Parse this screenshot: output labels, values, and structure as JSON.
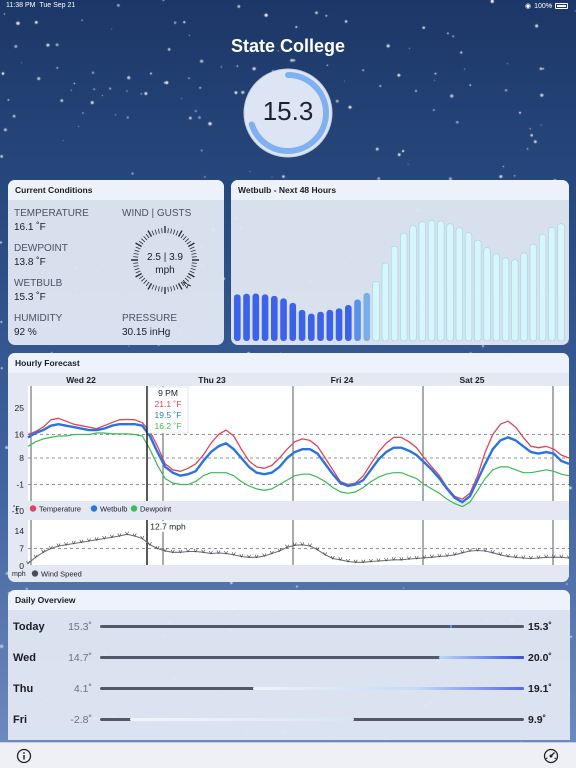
{
  "status": {
    "time": "11:38 PM",
    "date": "Tue Sep 21",
    "battery": "100%"
  },
  "location": {
    "name": "State College"
  },
  "wetbulb_gauge": {
    "value": "15.3",
    "fraction": 0.7
  },
  "current": {
    "title": "Current Conditions",
    "temperature": {
      "label": "TEMPERATURE",
      "value": "16.1 ˚F"
    },
    "dewpoint": {
      "label": "DEWPOINT",
      "value": "13.8 ˚F"
    },
    "wetbulb": {
      "label": "WETBULB",
      "value": "15.3 ˚F"
    },
    "humidity": {
      "label": "HUMIDITY",
      "value": "92 %"
    },
    "wind": {
      "label": "WIND | GUSTS",
      "value": "2.5 | 3.9",
      "unit": "mph"
    },
    "pressure": {
      "label": "PRESSURE",
      "value": "30.15 inHg"
    }
  },
  "wetbulb48": {
    "title": "Wetbulb - Next 48 Hours",
    "values": [
      15.3,
      15.5,
      15.6,
      15.3,
      14.8,
      14,
      12.5,
      10.2,
      9,
      9.6,
      10.2,
      10.7,
      11.8,
      13.6,
      15.8,
      19.6,
      25.6,
      31.1,
      35.4,
      37.9,
      39.2,
      39.6,
      39.4,
      38.5,
      37.2,
      35.6,
      33.1,
      30.7,
      28.6,
      27.3,
      26.7,
      28.9,
      31.8,
      35.1,
      37.3,
      38.5
    ]
  },
  "hourly": {
    "title": "Hourly Forecast",
    "days": [
      "Wed 22",
      "Thu 23",
      "Fri 24",
      "Sat 25"
    ],
    "y_ticks": [
      "25",
      "16",
      "8",
      "-1",
      "-10"
    ],
    "unit": "˚F",
    "tooltip": {
      "time": "9 PM",
      "temperature": "21.1 ˚F",
      "wetbulb": "19.5 ˚F",
      "dewpoint": "16.2 ˚F"
    },
    "legend": {
      "temperature": "Temperature",
      "wetbulb": "Wetbulb",
      "dewpoint": "Dewpoint"
    },
    "colors": {
      "temperature": "#e0435a",
      "wetbulb": "#2a74e0",
      "dewpoint": "#3cba55"
    },
    "temperature": [
      16,
      17,
      18.5,
      21,
      21.5,
      20.5,
      19.5,
      19,
      18.5,
      18,
      19,
      20,
      21,
      21.1,
      21,
      20,
      17,
      12,
      6,
      4,
      3.5,
      4.5,
      6,
      9,
      13,
      16,
      17.5,
      15.5,
      11,
      7,
      5,
      4.5,
      5.5,
      8,
      11,
      13.5,
      14.5,
      14,
      12,
      8,
      4,
      0,
      -1,
      -0.5,
      2,
      6,
      10,
      13,
      15,
      15,
      13.5,
      11.5,
      8,
      5,
      2,
      -2,
      -5,
      -6,
      -4,
      2,
      10,
      16,
      19.5,
      20.5,
      18.5,
      15,
      12,
      11.5,
      12,
      11,
      9,
      8
    ],
    "wetbulb": [
      15,
      16.5,
      17.5,
      19,
      19.5,
      19,
      18.5,
      18,
      17.5,
      17.5,
      18,
      19,
      19.5,
      19.5,
      19.5,
      19,
      15.5,
      10,
      5,
      3,
      2,
      2.5,
      3.5,
      7,
      10,
      12,
      13,
      11,
      8,
      5,
      3,
      2.5,
      3,
      5,
      8,
      10,
      11,
      11,
      9.5,
      6,
      2.5,
      -0.5,
      -1.5,
      -1,
      0.5,
      4,
      7.5,
      10,
      11.5,
      11.5,
      10.5,
      9,
      6.5,
      4,
      1,
      -2.5,
      -5.5,
      -7,
      -5,
      0.5,
      6,
      11,
      14,
      15,
      14,
      12,
      10,
      9.5,
      10,
      9.5,
      7,
      6
    ],
    "dewpoint": [
      12,
      13.5,
      14.5,
      15,
      15.5,
      15.5,
      16,
      16,
      16,
      16.5,
      16.5,
      16.2,
      16.2,
      16.2,
      16,
      15.5,
      11,
      5.5,
      1,
      -0.5,
      -1,
      -1,
      0,
      2,
      3,
      3,
      3,
      2,
      0,
      -1.5,
      -2.5,
      -3,
      -2.5,
      -1,
      0.5,
      2,
      2.5,
      2.5,
      1.5,
      0,
      -2,
      -3.5,
      -4,
      -3.5,
      -2,
      0,
      1.5,
      2.5,
      3,
      3,
      2,
      1,
      -1,
      -2.5,
      -4,
      -6,
      -7.5,
      -8.5,
      -7,
      -3,
      1,
      4,
      5,
      5,
      4,
      3,
      3,
      3.5,
      4,
      3.5,
      2.5,
      2
    ],
    "wind_title": "12.7 mph",
    "wind_ticks": [
      "14",
      "7",
      "0"
    ],
    "wind_unit": "mph",
    "wind_legend": "Wind Speed",
    "wind": [
      1,
      3.5,
      5.5,
      7,
      8,
      8.5,
      9,
      9.5,
      10,
      10.5,
      11,
      11.5,
      12,
      12.7,
      12,
      11,
      8.5,
      7,
      6,
      5.5,
      5.5,
      5.8,
      5.8,
      5.5,
      5,
      5.2,
      5,
      4.5,
      3.8,
      3.5,
      3.5,
      4,
      5,
      6,
      7.5,
      8.3,
      8.5,
      8,
      6.5,
      4.5,
      3,
      2.5,
      1.8,
      1.5,
      1.5,
      1.8,
      2,
      2.2,
      2.5,
      2.5,
      2.8,
      3,
      3.3,
      3.5,
      3.8,
      4,
      4.5,
      5.3,
      6,
      6.2,
      6,
      5.3,
      4.5,
      3.8,
      3.5,
      3.2,
      3,
      3.2,
      3.5,
      3.5,
      3.5,
      3.2
    ]
  },
  "daily": {
    "title": "Daily Overview",
    "rows": [
      {
        "day": "Today",
        "lo": "15.3˚",
        "hi": "15.3˚",
        "start": 0.825,
        "end": 0.83
      },
      {
        "day": "Wed",
        "lo": "14.7˚",
        "hi": "20.0˚",
        "start": 0.8,
        "end": 1.0
      },
      {
        "day": "Thu",
        "lo": "4.1˚",
        "hi": "19.1˚",
        "start": 0.36,
        "end": 1.0
      },
      {
        "day": "Fri",
        "lo": "-2.8˚",
        "hi": "9.9˚",
        "start": 0.07,
        "end": 0.6
      }
    ]
  }
}
